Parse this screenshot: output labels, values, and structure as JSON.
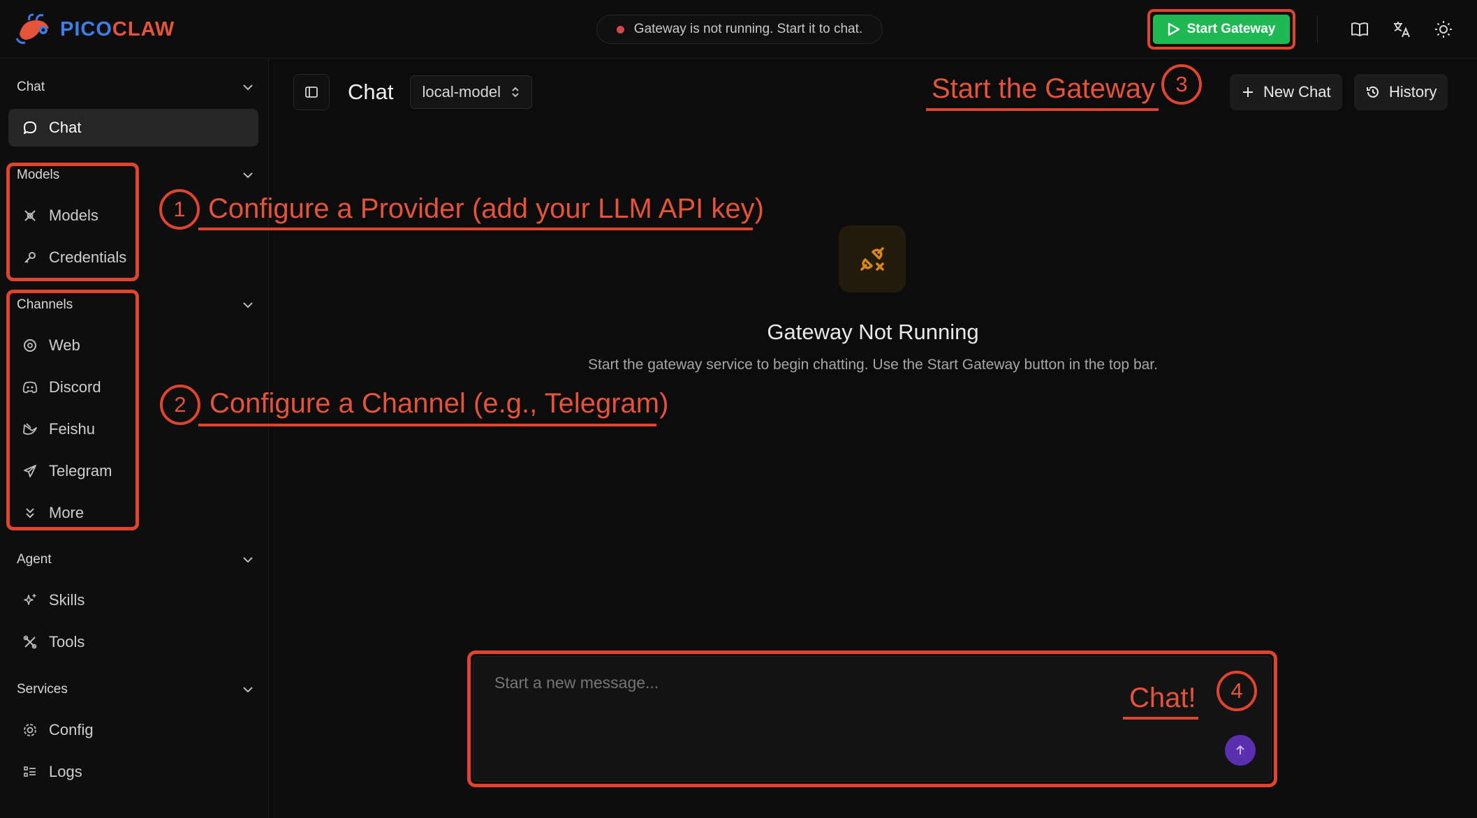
{
  "brand": {
    "logo_part1": "PICO",
    "logo_part2": "CLAW"
  },
  "topbar": {
    "status_text": "Gateway is not running. Start it to chat.",
    "start_gateway_label": "Start Gateway",
    "icons": [
      "book-icon",
      "translate-icon",
      "sun-icon"
    ]
  },
  "sidebar": {
    "sections": [
      {
        "title": "Chat",
        "items": [
          {
            "label": "Chat",
            "icon": "chat-bubble-icon",
            "active": true
          }
        ]
      },
      {
        "title": "Models",
        "items": [
          {
            "label": "Models",
            "icon": "models-icon"
          },
          {
            "label": "Credentials",
            "icon": "key-icon"
          }
        ]
      },
      {
        "title": "Channels",
        "items": [
          {
            "label": "Web",
            "icon": "globe-icon"
          },
          {
            "label": "Discord",
            "icon": "discord-icon"
          },
          {
            "label": "Feishu",
            "icon": "feishu-icon"
          },
          {
            "label": "Telegram",
            "icon": "telegram-icon"
          },
          {
            "label": "More",
            "icon": "chevrons-down-icon"
          }
        ]
      },
      {
        "title": "Agent",
        "items": [
          {
            "label": "Skills",
            "icon": "sparkles-icon"
          },
          {
            "label": "Tools",
            "icon": "tools-icon"
          }
        ]
      },
      {
        "title": "Services",
        "items": [
          {
            "label": "Config",
            "icon": "gear-icon"
          },
          {
            "label": "Logs",
            "icon": "logs-icon"
          }
        ]
      }
    ]
  },
  "main": {
    "title": "Chat",
    "model_selected": "local-model",
    "new_chat_label": "New Chat",
    "history_label": "History",
    "empty_title": "Gateway Not Running",
    "empty_subtitle": "Start the gateway service to begin chatting. Use the Start Gateway button in the top bar.",
    "composer_placeholder": "Start a new message..."
  },
  "annotations": [
    {
      "number": "1",
      "text": "Configure a Provider (add your LLM API key)"
    },
    {
      "number": "2",
      "text": "Configure a Channel (e.g., Telegram)"
    },
    {
      "number": "3",
      "text": "Start the Gateway"
    },
    {
      "number": "4",
      "text": "Chat!"
    }
  ],
  "colors": {
    "accent_red": "#e0442f",
    "start_green": "#1fb954",
    "send_purple": "#5a2fb0",
    "status_dot": "#d64848"
  }
}
